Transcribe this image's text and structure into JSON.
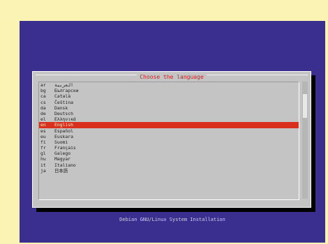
{
  "dialog": {
    "title": "Choose the language",
    "languages": [
      {
        "code": "ar",
        "label": "العربية"
      },
      {
        "code": "bg",
        "label": "Български"
      },
      {
        "code": "ca",
        "label": "Català"
      },
      {
        "code": "cs",
        "label": "Čeština"
      },
      {
        "code": "da",
        "label": "Dansk"
      },
      {
        "code": "de",
        "label": "Deutsch"
      },
      {
        "code": "el",
        "label": "Ελληνικά"
      },
      {
        "code": "en",
        "label": "English"
      },
      {
        "code": "es",
        "label": "Español"
      },
      {
        "code": "eu",
        "label": "Euskara"
      },
      {
        "code": "fi",
        "label": "Suomi"
      },
      {
        "code": "fr",
        "label": "Français"
      },
      {
        "code": "gl",
        "label": "Galego"
      },
      {
        "code": "hu",
        "label": "Magyar"
      },
      {
        "code": "it",
        "label": "Italiano"
      },
      {
        "code": "ja",
        "label": "日本語"
      }
    ],
    "selected_index": 7
  },
  "footer": {
    "text": "Debian GNU/Linux System Installation"
  },
  "colors": {
    "background": "#3a2f8f",
    "dialog": "#c4c4c4",
    "highlight": "#d8301c",
    "border_outer": "#fbf3b3"
  }
}
